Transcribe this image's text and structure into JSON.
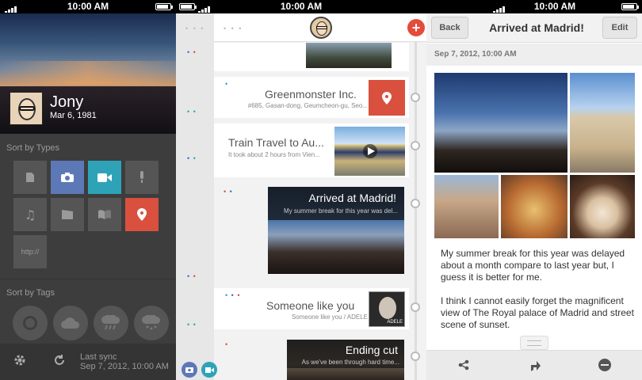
{
  "status": {
    "time": "10:00 AM"
  },
  "profile": {
    "name": "Jony",
    "date": "Mar 6, 1981",
    "sort_types_label": "Sort by Types",
    "sort_tags_label": "Sort by Tags",
    "http_tile": "http://",
    "sync_label": "Last sync",
    "sync_time": "Sep 7, 2012, 10:00 AM",
    "type_icons": [
      "document-icon",
      "camera-icon",
      "video-icon",
      "microphone-icon",
      "music-icon",
      "film-icon",
      "book-icon",
      "location-pin-icon",
      "link-icon"
    ],
    "tag_icons": [
      "sun-icon",
      "cloud-icon",
      "rain-icon",
      "snow-icon"
    ],
    "colors": {
      "camera": "#5d78b6",
      "video": "#2ea3b8",
      "location": "#d9503f"
    }
  },
  "timeline": {
    "entries": [
      {
        "title": "Greenmonster Inc.",
        "subtitle": "#685, Gasan-dong, Geumcheon-gu, Seo..."
      },
      {
        "title": "Train Travel to Au...",
        "subtitle": "It took about 2 hours from Vien..."
      },
      {
        "title": "Arrived at Madrid!",
        "subtitle": "My summer break for this year was del..."
      },
      {
        "title": "Someone like you",
        "subtitle": "Someone like you / ADELE",
        "album_label": "ADELE"
      },
      {
        "title": "Ending cut",
        "subtitle": "As we've been through hard time..."
      }
    ],
    "accent": "#e44b3a"
  },
  "detail": {
    "back_label": "Back",
    "title": "Arrived at Madrid!",
    "edit_label": "Edit",
    "date": "Sep 7, 2012, 10:00 AM",
    "paragraph1": "My summer break for this year was delayed about a month compare to last year but, I guess it is better for me.",
    "paragraph2": "I think I cannot easily forget the magnificent view of The Royal palace of Madrid and street scene of sunset."
  }
}
